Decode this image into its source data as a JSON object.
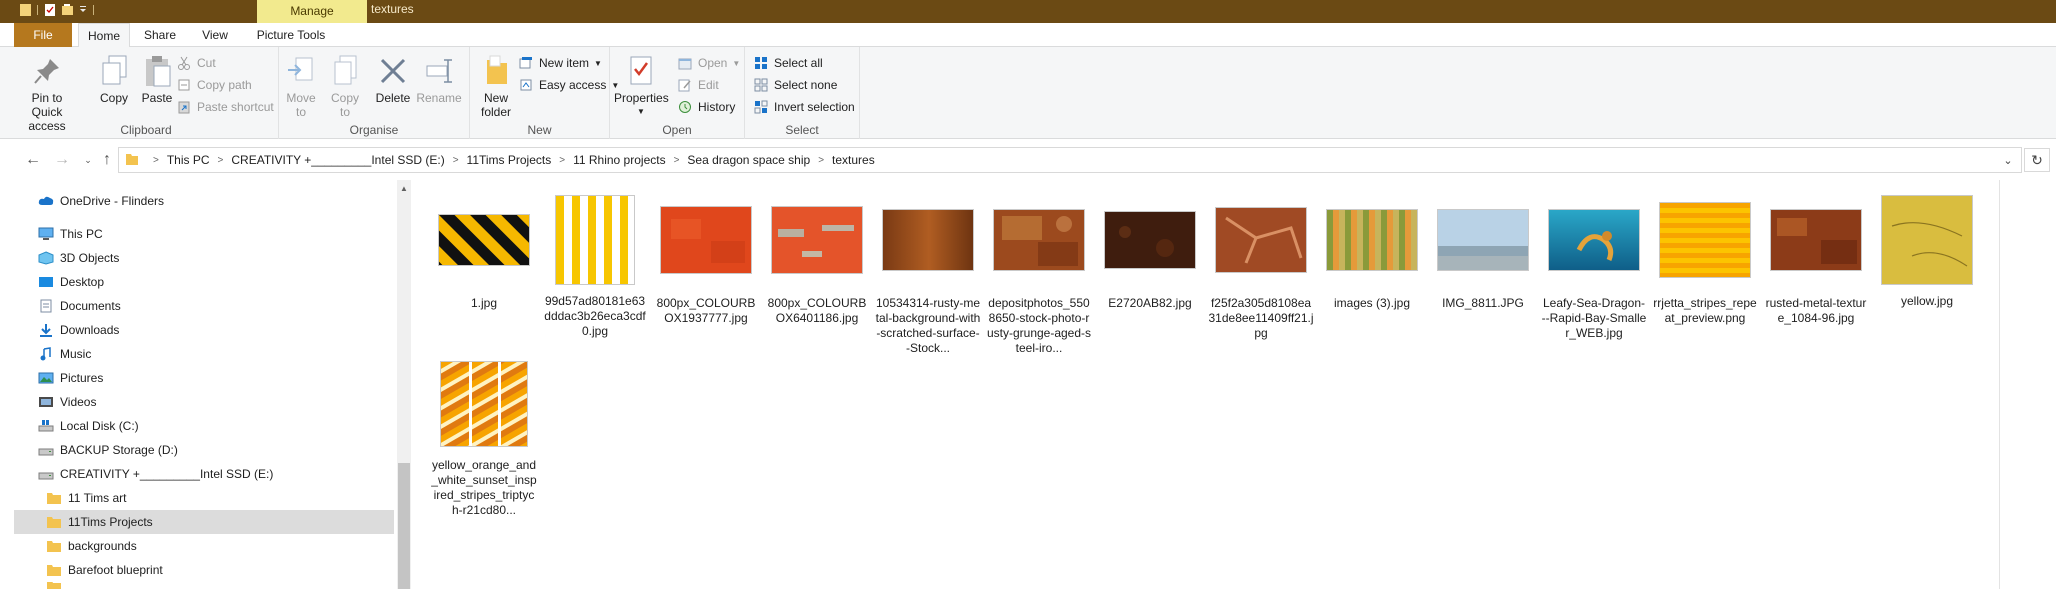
{
  "window": {
    "title": "textures",
    "context_tab": "Manage"
  },
  "ribbon_tabs": [
    "File",
    "Home",
    "Share",
    "View",
    "Picture Tools"
  ],
  "ribbon": {
    "clipboard": {
      "label": "Clipboard",
      "pin": "Pin to Quick access",
      "copy": "Copy",
      "paste": "Paste",
      "cut": "Cut",
      "copy_path": "Copy path",
      "paste_shortcut": "Paste shortcut"
    },
    "organise": {
      "label": "Organise",
      "move_to": "Move to",
      "copy_to": "Copy to",
      "delete": "Delete",
      "rename": "Rename"
    },
    "new": {
      "label": "New",
      "new_folder": "New folder",
      "new_item": "New item",
      "easy_access": "Easy access"
    },
    "open": {
      "label": "Open",
      "properties": "Properties",
      "open": "Open",
      "edit": "Edit",
      "history": "History"
    },
    "select": {
      "label": "Select",
      "select_all": "Select all",
      "select_none": "Select none",
      "invert_selection": "Invert selection"
    }
  },
  "address": {
    "breadcrumbs": [
      "This PC",
      "CREATIVITY +_________Intel SSD (E:)",
      "11Tims Projects",
      "11 Rhino projects",
      "Sea dragon space ship",
      "textures"
    ]
  },
  "nav_tree": [
    {
      "label": "OneDrive - Flinders",
      "icon": "cloud-icon"
    },
    {
      "label": "This PC",
      "icon": "computer-icon"
    },
    {
      "label": "3D Objects",
      "icon": "cube-icon"
    },
    {
      "label": "Desktop",
      "icon": "desktop-icon"
    },
    {
      "label": "Documents",
      "icon": "documents-icon"
    },
    {
      "label": "Downloads",
      "icon": "downloads-icon"
    },
    {
      "label": "Music",
      "icon": "music-icon"
    },
    {
      "label": "Pictures",
      "icon": "pictures-icon"
    },
    {
      "label": "Videos",
      "icon": "videos-icon"
    },
    {
      "label": "Local Disk (C:)",
      "icon": "drive-icon"
    },
    {
      "label": "BACKUP Storage (D:)",
      "icon": "drive-icon"
    },
    {
      "label": "CREATIVITY +_________Intel SSD (E:)",
      "icon": "drive-icon"
    },
    {
      "label": "11 Tims art",
      "icon": "folder-icon"
    },
    {
      "label": "11Tims Projects",
      "icon": "folder-icon",
      "selected": true
    },
    {
      "label": "backgrounds",
      "icon": "folder-icon"
    },
    {
      "label": "Barefoot blueprint",
      "icon": "folder-icon"
    }
  ],
  "files": [
    {
      "name": "1.jpg",
      "thumb": "black-yellow-hazard-stripes"
    },
    {
      "name": "99d57ad80181e63dddac3b26eca3cdf0.jpg",
      "thumb": "yellow-white-vertical-stripes"
    },
    {
      "name": "800px_COLOURBOX1937777.jpg",
      "thumb": "orange-rough-texture"
    },
    {
      "name": "800px_COLOURBOX6401186.jpg",
      "thumb": "orange-peeling-paint"
    },
    {
      "name": "10534314-rusty-metal-background-with-scratched-surface--Stock...",
      "thumb": "rusty-metal"
    },
    {
      "name": "depositphotos_5508650-stock-photo-rusty-grunge-aged-steel-iro...",
      "thumb": "rusty-grunge"
    },
    {
      "name": "E2720AB82.jpg",
      "thumb": "dark-rust-speckle"
    },
    {
      "name": "f25f2a305d8108ea31de8ee11409ff21.jpg",
      "thumb": "cracked-rust"
    },
    {
      "name": "images (3).jpg",
      "thumb": "green-orange-stripes"
    },
    {
      "name": "IMG_8811.JPG",
      "thumb": "beach-photo"
    },
    {
      "name": "Leafy-Sea-Dragon---Rapid-Bay-Smaller_WEB.jpg",
      "thumb": "leafy-sea-dragon"
    },
    {
      "name": "rrjetta_stripes_repeat_preview.png",
      "thumb": "orange-horizontal-stripes"
    },
    {
      "name": "rusted-metal-texture_1084-96.jpg",
      "thumb": "rusted-metal"
    },
    {
      "name": "yellow.jpg",
      "thumb": "yellow-paper"
    },
    {
      "name": "yellow_orange_and_white_sunset_inspired_stripes_triptych-r21cd80...",
      "thumb": "yellow-orange-triptych"
    }
  ],
  "colors": {
    "titlebar": "#6b4a14",
    "manage_tab": "#f2ea8e",
    "file_tab": "#b5781e",
    "ribbon_bg": "#f5f6f7",
    "selected_tree_item": "#dcdcdc",
    "accent_blue": "#1a73c9"
  }
}
